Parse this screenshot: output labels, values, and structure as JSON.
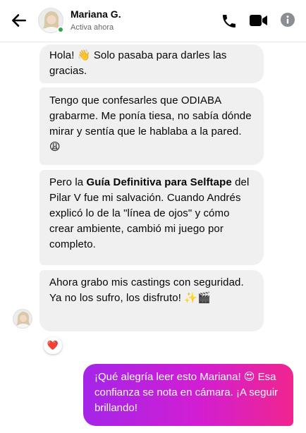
{
  "header": {
    "contact_name": "Mariana G.",
    "status": "Activa ahora",
    "icons": [
      "arrow-back-icon",
      "phone-icon",
      "video-camera-icon",
      "info-icon"
    ],
    "online_color": "#31a24c"
  },
  "messages": [
    {
      "sender": "Mariana G.",
      "text": "Hola! 👋 Solo pasaba para darles las gracias."
    },
    {
      "sender": "Mariana G.",
      "text": "Tengo que confesarles que ODIABA grabarme. Me ponía tiesa, no sabía dónde mirar y sentía que le hablaba a la pared. 😩"
    },
    {
      "sender": "Mariana G.",
      "text_before": "Pero la ",
      "text_bold": "Guía Definitiva para Selftape",
      "text_after": " del Pilar V fue mi salvación. Cuando Andrés explicó lo de la \"línea de ojos\" y cómo crear ambiente, cambió mi juego por completo."
    },
    {
      "sender": "Mariana G.",
      "text": "Ahora grabo mis castings con seguridad. Ya no los sufro, los disfruto! ✨🎬",
      "reaction": "❤️"
    },
    {
      "sender": "me",
      "text": "¡Qué alegría leer esto Mariana! 😍 Esa confianza se nota en cámara. ¡A seguir brillando!"
    }
  ],
  "colors": {
    "incoming_bubble": "#f0f0f0",
    "outgoing_gradient": [
      "#a425e8",
      "#d21ed3",
      "#f0258f"
    ],
    "icon": "#050505"
  }
}
